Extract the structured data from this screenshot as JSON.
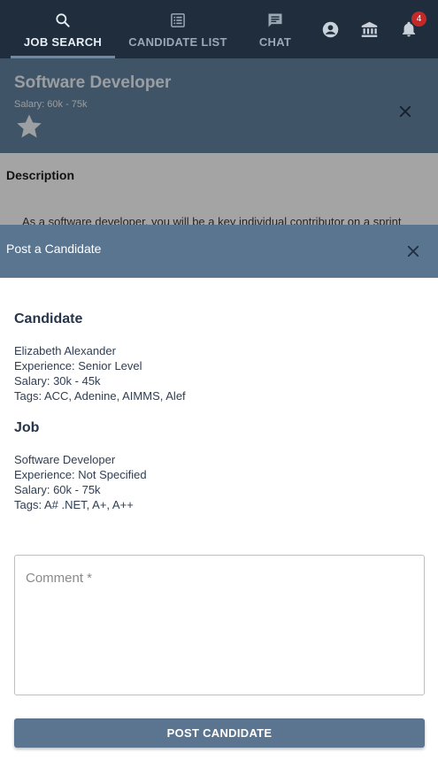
{
  "nav": {
    "tabs": [
      {
        "label": "JOB SEARCH",
        "icon": "search-icon",
        "active": true
      },
      {
        "label": "CANDIDATE LIST",
        "icon": "list-icon",
        "active": false
      },
      {
        "label": "CHAT",
        "icon": "chat-icon",
        "active": false
      }
    ],
    "actions": [
      "account-icon",
      "bank-icon",
      "bell-icon"
    ],
    "notification_count": "4"
  },
  "job": {
    "title": "Software Developer",
    "salary": "Salary: 60k - 75k",
    "description_heading": "Description",
    "description_text": "As a software developer, you will be a key individual contributor on a sprint"
  },
  "modal": {
    "title": "Post a Candidate",
    "candidate": {
      "heading": "Candidate",
      "name": "Elizabeth Alexander",
      "experience": "Experience: Senior Level",
      "salary": "Salary: 30k - 45k",
      "tags": "Tags: ACC, Adenine, AIMMS, Alef"
    },
    "job": {
      "heading": "Job",
      "title": "Software Developer",
      "experience": "Experience: Not Specified",
      "salary": "Salary: 60k - 75k",
      "tags": "Tags: A# .NET, A+, A++"
    },
    "comment": {
      "placeholder": "Comment *",
      "value": ""
    },
    "submit_label": "POST CANDIDATE"
  },
  "colors": {
    "nav_bg": "#1f2d3d",
    "header_bg": "#5a7590",
    "badge": "#c62828"
  }
}
